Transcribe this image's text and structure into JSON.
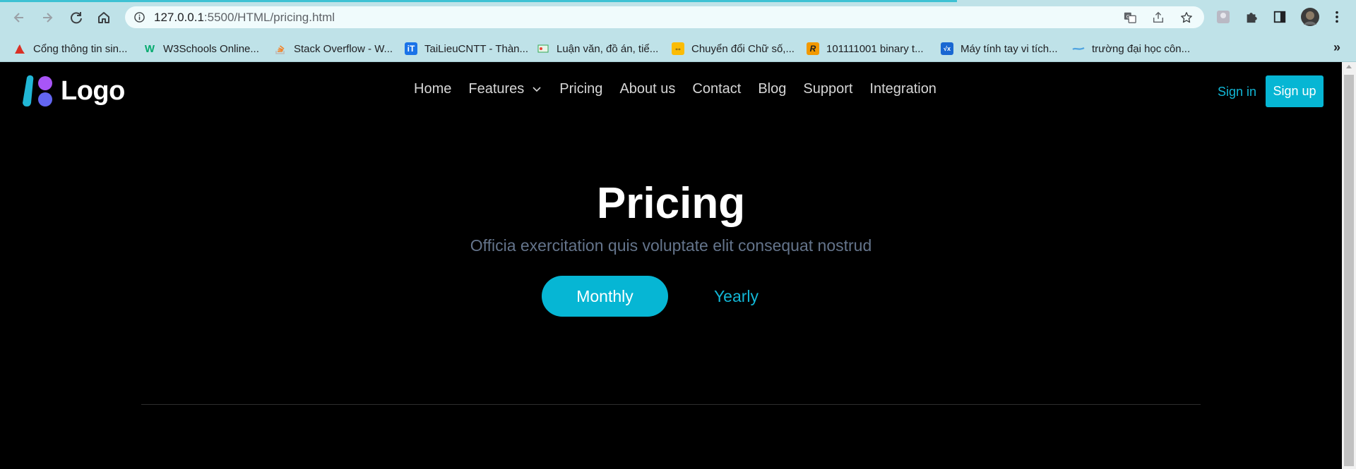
{
  "browser": {
    "url_host": "127.0.0.1",
    "url_path": ":5500/HTML/pricing.html",
    "bookmarks": [
      {
        "label": "Cổng thông tin sin...",
        "icon": "university-icon",
        "color": "#d93025"
      },
      {
        "label": "W3Schools Online...",
        "icon": "w3schools-icon",
        "color": "#04aa6d"
      },
      {
        "label": "Stack Overflow - W...",
        "icon": "stackoverflow-icon",
        "color": "#f48024"
      },
      {
        "label": "TaiLieuCNTT - Thàn...",
        "icon": "tailieu-icon",
        "color": "#1a73e8"
      },
      {
        "label": "Luận văn, đồ án, tiể...",
        "icon": "document-icon",
        "color": "#34a853"
      },
      {
        "label": "Chuyển đổi Chữ số,...",
        "icon": "converter-icon",
        "color": "#fbbc04"
      },
      {
        "label": "101111001 binary t...",
        "icon": "rapidtables-icon",
        "color": "#e37400"
      },
      {
        "label": "Máy tính tay vi tích...",
        "icon": "calculator-icon",
        "color": "#1967d2"
      },
      {
        "label": "trường đại học côn...",
        "icon": "link-icon",
        "color": "#4fa3e0"
      }
    ],
    "bookmark_more": "»"
  },
  "header": {
    "logo_text": "Logo",
    "nav": [
      "Home",
      "Features",
      "Pricing",
      "About us",
      "Contact",
      "Blog",
      "Support",
      "Integration"
    ],
    "sign_in": "Sign in",
    "sign_up": "Sign up"
  },
  "hero": {
    "title": "Pricing",
    "subtitle": "Officia exercitation quis voluptate elit consequat nostrud",
    "toggle": {
      "monthly": "Monthly",
      "yearly": "Yearly",
      "selected": "Monthly"
    }
  },
  "colors": {
    "accent": "#06b6d4",
    "background": "#000000",
    "chrome": "#bfe2e8"
  }
}
